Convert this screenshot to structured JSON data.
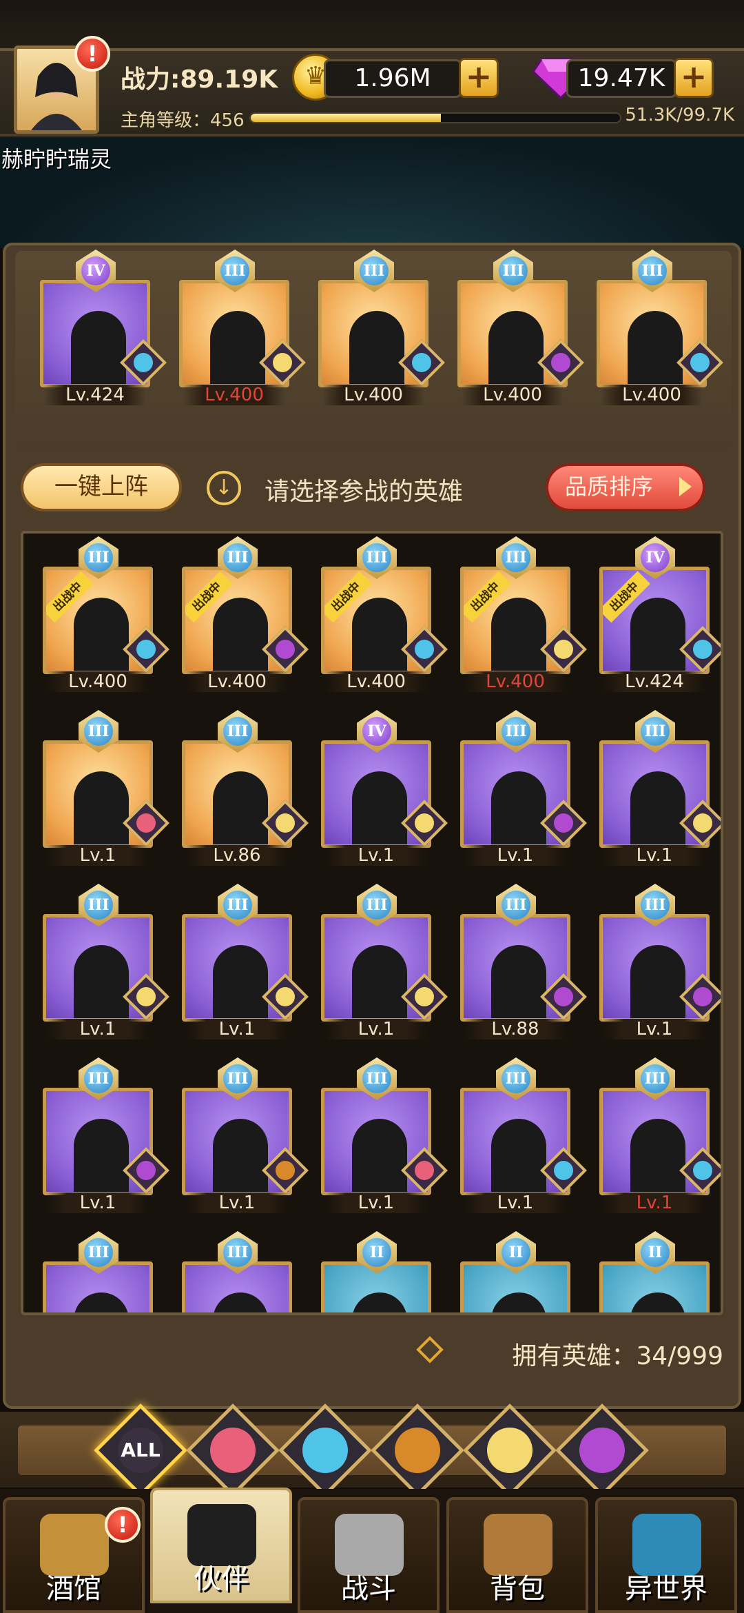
{
  "header": {
    "power": "战力:89.19K",
    "gold": "1.96M",
    "gems": "19.47K",
    "level_label": "主角等级：456",
    "exp_text": "51.3K/99.7K",
    "exp_progress": 0.514,
    "player_name": "赫眝眝瑞灵",
    "alert": "!"
  },
  "team": [
    {
      "rank": "IV",
      "lv": "Lv.424",
      "portrait": "purple",
      "faction": "water",
      "lv_red": false
    },
    {
      "rank": "III",
      "lv": "Lv.400",
      "portrait": "orange",
      "faction": "elf",
      "lv_red": true
    },
    {
      "rank": "III",
      "lv": "Lv.400",
      "portrait": "orange",
      "faction": "water",
      "lv_red": false
    },
    {
      "rank": "III",
      "lv": "Lv.400",
      "portrait": "orange",
      "faction": "demon",
      "lv_red": false
    },
    {
      "rank": "III",
      "lv": "Lv.400",
      "portrait": "orange",
      "faction": "water",
      "lv_red": false
    }
  ],
  "actions": {
    "one_click": "一键上阵",
    "hint": "请选择参战的英雄",
    "sort": "品质排序"
  },
  "roster": [
    {
      "rank": "III",
      "lv": "Lv.400",
      "portrait": "orange",
      "faction": "water",
      "tag": "出战中",
      "lv_red": false
    },
    {
      "rank": "III",
      "lv": "Lv.400",
      "portrait": "orange",
      "faction": "demon",
      "tag": "出战中",
      "lv_red": false
    },
    {
      "rank": "III",
      "lv": "Lv.400",
      "portrait": "orange",
      "faction": "water",
      "tag": "出战中",
      "lv_red": false
    },
    {
      "rank": "III",
      "lv": "Lv.400",
      "portrait": "orange",
      "faction": "elf",
      "tag": "出战中",
      "lv_red": true
    },
    {
      "rank": "IV",
      "lv": "Lv.424",
      "portrait": "purple",
      "faction": "water",
      "tag": "出战中",
      "lv_red": false
    },
    {
      "rank": "III",
      "lv": "Lv.1",
      "portrait": "orange",
      "faction": "human",
      "tag": "",
      "lv_red": false
    },
    {
      "rank": "III",
      "lv": "Lv.86",
      "portrait": "orange",
      "faction": "elf",
      "tag": "",
      "lv_red": false
    },
    {
      "rank": "IV",
      "lv": "Lv.1",
      "portrait": "purple",
      "faction": "elf",
      "tag": "",
      "lv_red": false
    },
    {
      "rank": "III",
      "lv": "Lv.1",
      "portrait": "purple",
      "faction": "demon",
      "tag": "",
      "lv_red": false
    },
    {
      "rank": "III",
      "lv": "Lv.1",
      "portrait": "purple",
      "faction": "elf",
      "tag": "",
      "lv_red": false
    },
    {
      "rank": "III",
      "lv": "Lv.1",
      "portrait": "purple",
      "faction": "elf",
      "tag": "",
      "lv_red": false
    },
    {
      "rank": "III",
      "lv": "Lv.1",
      "portrait": "purple",
      "faction": "elf",
      "tag": "",
      "lv_red": false
    },
    {
      "rank": "III",
      "lv": "Lv.1",
      "portrait": "purple",
      "faction": "elf",
      "tag": "",
      "lv_red": false
    },
    {
      "rank": "III",
      "lv": "Lv.88",
      "portrait": "purple",
      "faction": "demon",
      "tag": "",
      "lv_red": false
    },
    {
      "rank": "III",
      "lv": "Lv.1",
      "portrait": "purple",
      "faction": "demon",
      "tag": "",
      "lv_red": false
    },
    {
      "rank": "III",
      "lv": "Lv.1",
      "portrait": "purple",
      "faction": "demon",
      "tag": "",
      "lv_red": false
    },
    {
      "rank": "III",
      "lv": "Lv.1",
      "portrait": "purple",
      "faction": "lion",
      "tag": "",
      "lv_red": false
    },
    {
      "rank": "III",
      "lv": "Lv.1",
      "portrait": "purple",
      "faction": "human",
      "tag": "",
      "lv_red": false
    },
    {
      "rank": "III",
      "lv": "Lv.1",
      "portrait": "purple",
      "faction": "water",
      "tag": "",
      "lv_red": false
    },
    {
      "rank": "III",
      "lv": "Lv.1",
      "portrait": "purple",
      "faction": "water",
      "tag": "",
      "lv_red": true
    },
    {
      "rank": "III",
      "lv": "",
      "portrait": "purple",
      "faction": "human",
      "tag": "",
      "lv_red": false
    },
    {
      "rank": "III",
      "lv": "",
      "portrait": "purple",
      "faction": "human",
      "tag": "",
      "lv_red": false
    },
    {
      "rank": "II",
      "lv": "",
      "portrait": "blue",
      "faction": "elf",
      "tag": "",
      "lv_red": false
    },
    {
      "rank": "II",
      "lv": "",
      "portrait": "blue",
      "faction": "water",
      "tag": "",
      "lv_red": false
    },
    {
      "rank": "II",
      "lv": "",
      "portrait": "blue",
      "faction": "human",
      "tag": "",
      "lv_red": false
    }
  ],
  "owned_heroes": "拥有英雄：34/999",
  "filters": [
    {
      "label": "ALL",
      "icon": "all-filter",
      "active": true
    },
    {
      "label": "",
      "icon": "human-faction-icon",
      "active": false
    },
    {
      "label": "",
      "icon": "water-faction-icon",
      "active": false
    },
    {
      "label": "",
      "icon": "lion-faction-icon",
      "active": false
    },
    {
      "label": "",
      "icon": "elf-faction-icon",
      "active": false
    },
    {
      "label": "",
      "icon": "demon-faction-icon",
      "active": false
    }
  ],
  "nav": [
    {
      "label": "酒馆",
      "icon": "beer-mug-icon",
      "active": false,
      "alert": true
    },
    {
      "label": "伙伴",
      "icon": "companion-icon",
      "active": true,
      "alert": false
    },
    {
      "label": "战斗",
      "icon": "crossed-swords-icon",
      "active": false,
      "alert": false
    },
    {
      "label": "背包",
      "icon": "backpack-icon",
      "active": false,
      "alert": false
    },
    {
      "label": "异世界",
      "icon": "portal-icon",
      "active": false,
      "alert": false
    }
  ],
  "colors": {
    "orange_portrait": "#f0a650",
    "purple_portrait": "#8a5ed4",
    "blue_portrait": "#4aa6c6",
    "gold_accent": "#f1c65c",
    "sort_button": "#e14b3c"
  }
}
